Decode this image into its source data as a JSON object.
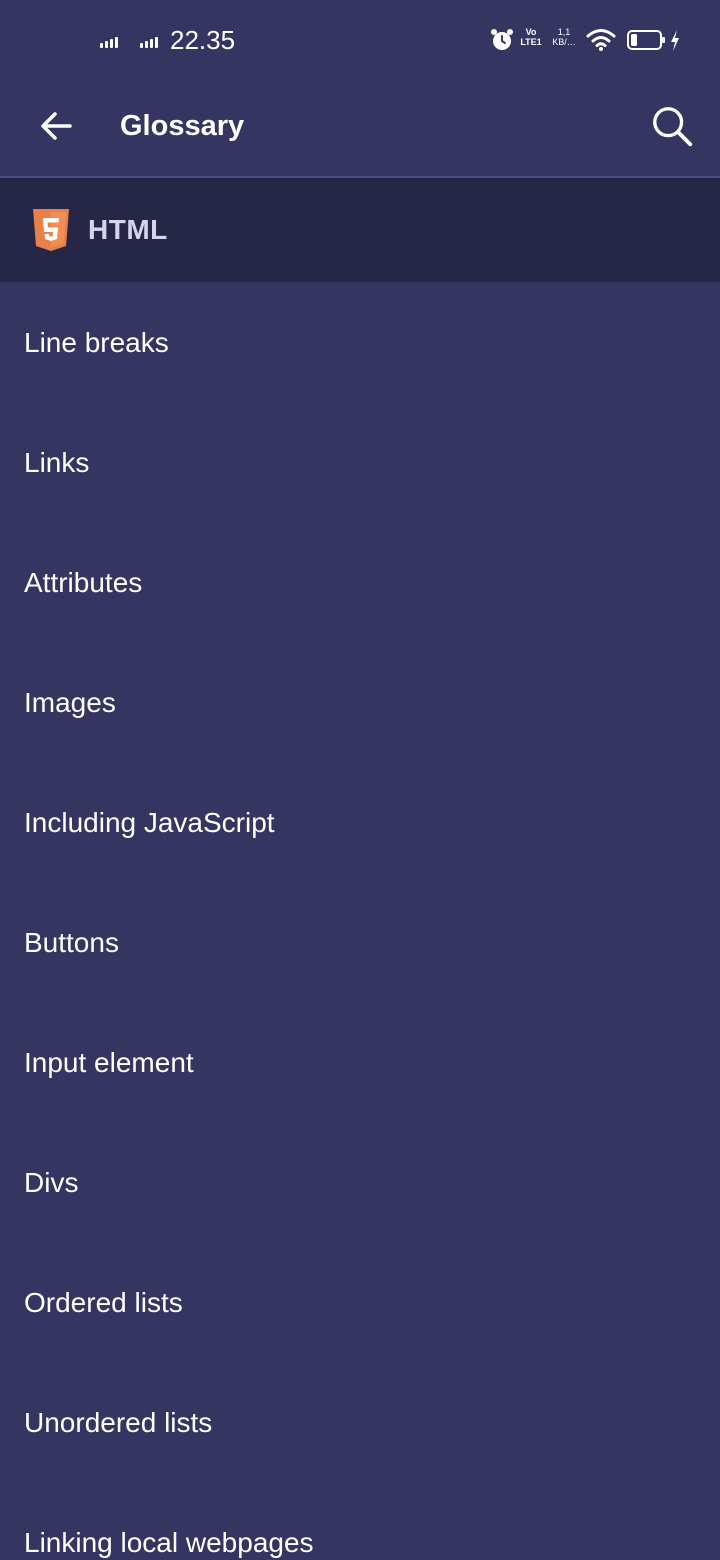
{
  "status_bar": {
    "time": "22.35",
    "volte_line1": "Vo",
    "volte_line2": "LTE1",
    "speed_line1": "1,1",
    "speed_line2": "KB/…",
    "icons": [
      "signal-icon",
      "signal-icon",
      "alarm-icon",
      "volte-icon",
      "data-speed",
      "wifi-icon",
      "battery-icon",
      "charging-icon"
    ]
  },
  "app_bar": {
    "title": "Glossary",
    "back_icon": "arrow-left-icon",
    "search_icon": "search-icon"
  },
  "section": {
    "title": "HTML",
    "logo_icon": "html5-logo",
    "logo_glyph": "5",
    "logo_color": "#e8804a"
  },
  "colors": {
    "background": "#343561",
    "section_background": "#262746",
    "text": "#ffffff"
  },
  "items": [
    {
      "label": "Line breaks"
    },
    {
      "label": "Links"
    },
    {
      "label": "Attributes"
    },
    {
      "label": "Images"
    },
    {
      "label": "Including JavaScript"
    },
    {
      "label": "Buttons"
    },
    {
      "label": "Input element"
    },
    {
      "label": "Divs"
    },
    {
      "label": "Ordered lists"
    },
    {
      "label": "Unordered lists"
    },
    {
      "label": "Linking local webpages"
    }
  ]
}
